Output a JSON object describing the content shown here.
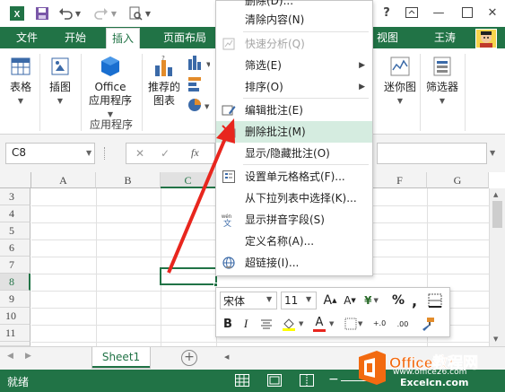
{
  "qat": {
    "icons": [
      "excel-logo-icon",
      "save-icon",
      "undo-icon",
      "redo-icon",
      "print-preview-icon"
    ]
  },
  "window": {
    "help": "?",
    "minimize": "—",
    "close": "✕"
  },
  "tabs": [
    "文件",
    "开始",
    "插入",
    "页面布局",
    "视图"
  ],
  "active_tab": "插入",
  "user": "王涛",
  "ribbon": {
    "table": "表格",
    "illustrations": "插图",
    "office_apps_line1": "Office",
    "office_apps_line2": "应用程序",
    "recommended_line1": "推荐的",
    "recommended_line2": "图表",
    "group_apps": "应用程序",
    "sparklines": "迷你图",
    "filter": "筛选器"
  },
  "formula_bar": {
    "name_box": "C8",
    "cancel": "✕",
    "enter": "✓",
    "fx": "fx"
  },
  "grid": {
    "columns": [
      "A",
      "B",
      "C",
      "F",
      "G"
    ],
    "rows": [
      "3",
      "4",
      "5",
      "6",
      "7",
      "8",
      "9",
      "10",
      "11",
      "12"
    ]
  },
  "sheet_tab": "Sheet1",
  "status": {
    "ready": "就绪"
  },
  "context_menu": {
    "items": [
      {
        "label": "删除(D)...",
        "icon": ""
      },
      {
        "label": "清除内容(N)",
        "icon": ""
      },
      {
        "label": "快速分析(Q)",
        "icon": "quick-analysis-icon",
        "disabled": true
      },
      {
        "label": "筛选(E)",
        "icon": "",
        "submenu": true
      },
      {
        "label": "排序(O)",
        "icon": "",
        "submenu": true
      },
      {
        "label": "编辑批注(E)",
        "icon": "edit-comment-icon"
      },
      {
        "label": "删除批注(M)",
        "icon": "delete-comment-icon",
        "highlighted": true
      },
      {
        "label": "显示/隐藏批注(O)",
        "icon": ""
      },
      {
        "label": "设置单元格格式(F)...",
        "icon": "format-cells-icon"
      },
      {
        "label": "从下拉列表中选择(K)...",
        "icon": ""
      },
      {
        "label": "显示拼音字段(S)",
        "icon": "phonetic-icon"
      },
      {
        "label": "定义名称(A)...",
        "icon": ""
      },
      {
        "label": "超链接(I)...",
        "icon": "hyperlink-icon"
      }
    ]
  },
  "mini_toolbar": {
    "font": "宋体",
    "size": "11",
    "grow": "A",
    "shrink": "A",
    "currency": "¥",
    "percent": "%",
    "comma": ",",
    "bold": "B",
    "italic": "I",
    "font_color_letter": "A",
    "inc_decimal": "+.0",
    "dec_decimal": ".00"
  },
  "watermark": {
    "brand": "Office教程网",
    "url": "www.office26.com",
    "url2": "Excelcn.com"
  },
  "colors": {
    "excel_green": "#217346",
    "highlight": "#d5ece0",
    "arrow_red": "#e8261e",
    "watermark_orange": "#f26a10"
  }
}
